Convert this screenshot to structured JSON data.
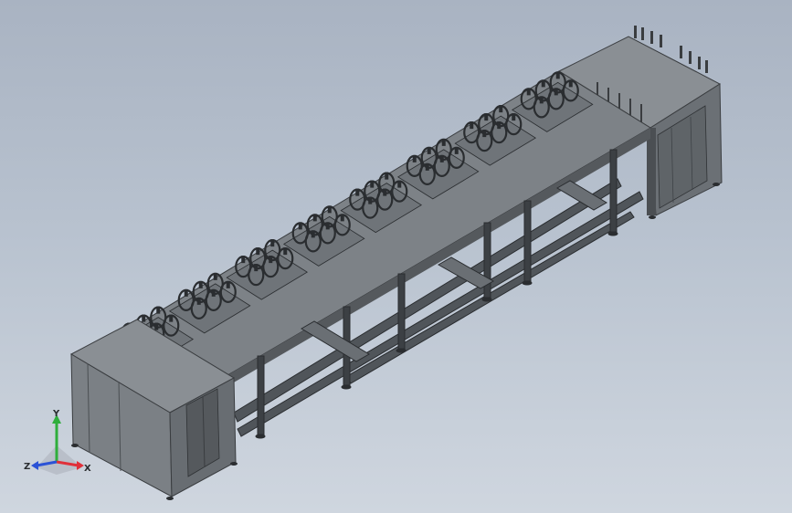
{
  "viewport": {
    "background_top": "#a9b3c2",
    "background_bottom": "#cfd6df"
  },
  "model": {
    "name": "",
    "frame_color": "#5c6166",
    "panel_color": "#7b8085",
    "dark_color": "#2a2d30",
    "stations": 8
  },
  "triad": {
    "x_label": "X",
    "y_label": "Y",
    "z_label": "Z",
    "x_color": "#e0303a",
    "y_color": "#2fae3c",
    "z_color": "#2b52d6"
  }
}
